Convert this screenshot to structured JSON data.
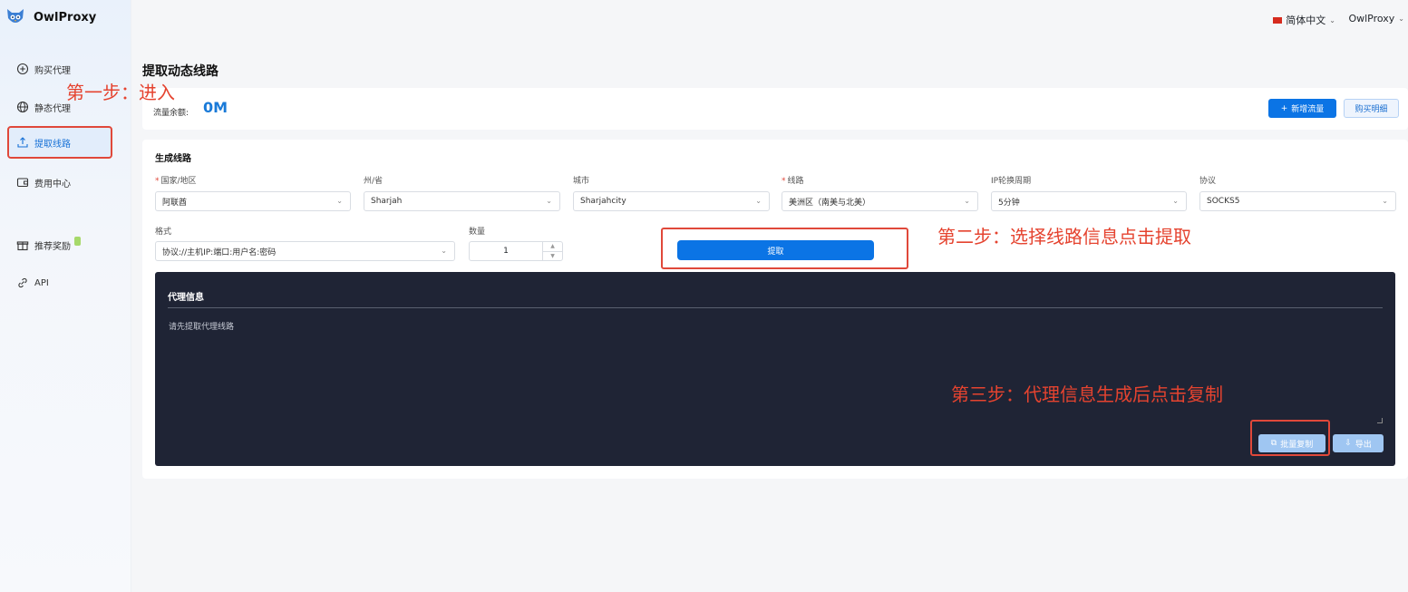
{
  "brand": {
    "name": "OwlProxy"
  },
  "sidebar": {
    "items": [
      {
        "label": "购买代理",
        "icon": "plus-circle-icon"
      },
      {
        "label": "静态代理",
        "icon": "globe-icon"
      },
      {
        "label": "提取线路",
        "icon": "upload-icon",
        "active": true
      },
      {
        "label": "费用中心",
        "icon": "wallet-icon"
      },
      {
        "label": "推荐奖励",
        "icon": "gift-icon"
      },
      {
        "label": "API",
        "icon": "link-icon"
      }
    ]
  },
  "topbar": {
    "language": "简体中文",
    "user": "OwlProxy"
  },
  "page": {
    "title": "提取动态线路"
  },
  "balance": {
    "label": "流量余额:",
    "value": "0M",
    "add_button": "新增流量",
    "detail_button": "购买明细"
  },
  "form": {
    "section_title": "生成线路",
    "fields": {
      "country": {
        "label": "国家/地区",
        "required": true,
        "value": "阿联酋"
      },
      "state": {
        "label": "州/省",
        "required": false,
        "value": "Sharjah"
      },
      "city": {
        "label": "城市",
        "required": false,
        "value": "Sharjahcity"
      },
      "route": {
        "label": "线路",
        "required": true,
        "value": "美洲区（南美与北美）"
      },
      "rotation": {
        "label": "IP轮换周期",
        "required": false,
        "value": "5分钟"
      },
      "protocol": {
        "label": "协议",
        "required": false,
        "value": "SOCKS5"
      },
      "format": {
        "label": "格式",
        "required": false,
        "value": "协议://主机IP:端口:用户名:密码"
      },
      "quantity": {
        "label": "数量",
        "required": false,
        "value": "1"
      }
    },
    "extract_button": "提取"
  },
  "proxy_info": {
    "title": "代理信息",
    "hint": "请先提取代理线路",
    "copy_button": "批量复制",
    "export_button": "导出"
  },
  "annotations": {
    "step1": "第一步：进入",
    "step2": "第二步：选择线路信息点击提取",
    "step3": "第三步：代理信息生成后点击复制"
  },
  "colors": {
    "accent": "#0b74e5",
    "annotation": "#e5432f",
    "panel": "#1f2435"
  }
}
